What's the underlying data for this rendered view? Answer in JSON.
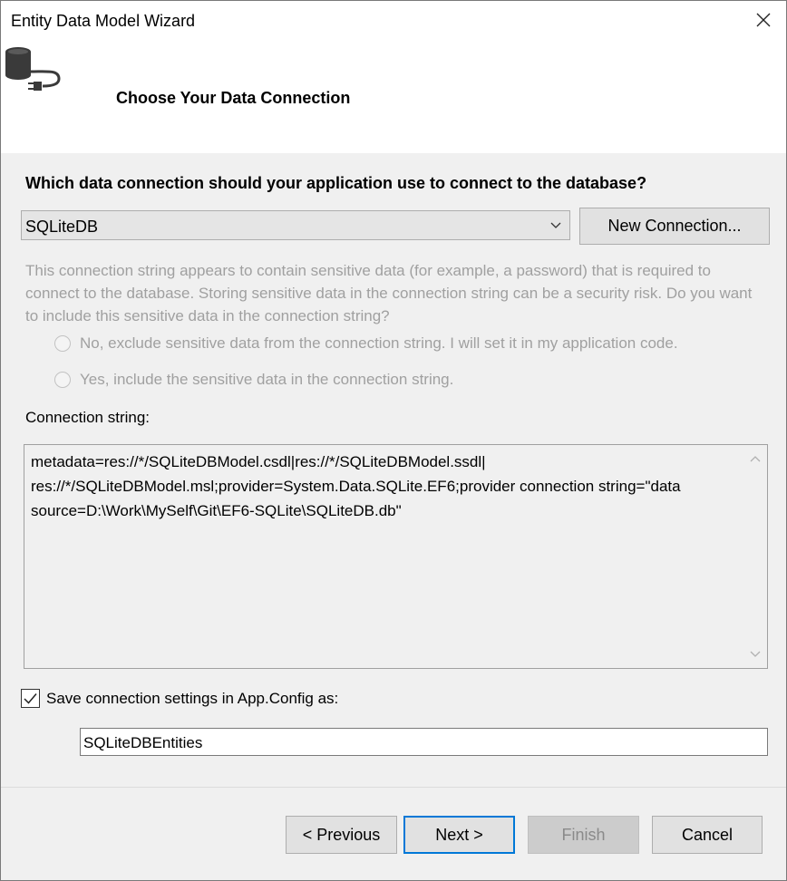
{
  "window": {
    "title": "Entity Data Model Wizard",
    "close_icon": "close-icon"
  },
  "header": {
    "icon": "database-connection-icon",
    "heading": "Choose Your Data Connection"
  },
  "connection": {
    "question": "Which data connection should your application use to connect to the database?",
    "selected": "SQLiteDB",
    "new_connection_label": "New Connection...",
    "sensitive_text": "This connection string appears to contain sensitive data (for example, a password) that is required to connect to the database. Storing sensitive data in the connection string can be a security risk. Do you want to include this sensitive data in the connection string?",
    "option_exclude": "No, exclude sensitive data from the connection string. I will set it in my application code.",
    "option_include": "Yes, include the sensitive data in the connection string.",
    "connection_string_label": "Connection string:",
    "connection_string_value": "metadata=res://*/SQLiteDBModel.csdl|res://*/SQLiteDBModel.ssdl|\nres://*/SQLiteDBModel.msl;provider=System.Data.SQLite.EF6;provider connection string=\"data\nsource=D:\\Work\\MySelf\\Git\\EF6-SQLite\\SQLiteDB.db\""
  },
  "settings": {
    "save_checked": true,
    "save_label": "Save connection settings in App.Config as:",
    "entities_name": "SQLiteDBEntities"
  },
  "footer": {
    "previous_label": "< Previous",
    "next_label": "Next >",
    "finish_label": "Finish",
    "cancel_label": "Cancel"
  }
}
